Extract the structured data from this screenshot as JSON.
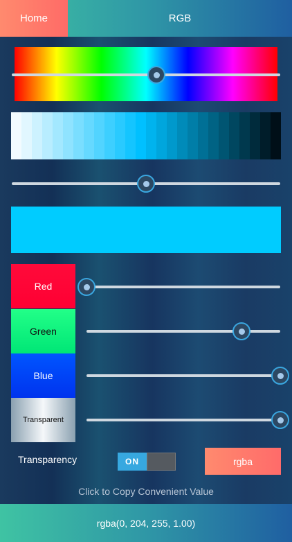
{
  "header": {
    "home_label": "Home",
    "title": "RGB"
  },
  "sliders": {
    "hue": 0.54,
    "shade": 0.5,
    "red": 0,
    "green": 0.8,
    "blue": 1.0,
    "alpha": 1.0
  },
  "preview_color": "#00ccff",
  "channels": {
    "red_label": "Red",
    "green_label": "Green",
    "blue_label": "Blue",
    "transparent_label": "Transparent"
  },
  "transparency": {
    "label": "Transparency",
    "toggle_state": "ON"
  },
  "rgba_button_label": "rgba",
  "copy_hint": "Click to Copy Convenient Value",
  "footer_value": "rgba(0, 204, 255, 1.00)",
  "shade_swatches": [
    "#f2fbff",
    "#e1f7ff",
    "#cdf2ff",
    "#b8edff",
    "#a3e8ff",
    "#8fe3ff",
    "#7adeff",
    "#66d9ff",
    "#52d4ff",
    "#3dcfff",
    "#29caff",
    "#14c5ff",
    "#00c0ff",
    "#00b3ee",
    "#00a6dd",
    "#0099cc",
    "#008bb9",
    "#007ea8",
    "#007096",
    "#006384",
    "#005572",
    "#004760",
    "#00394e",
    "#002b3c",
    "#001d2a",
    "#000f18"
  ]
}
